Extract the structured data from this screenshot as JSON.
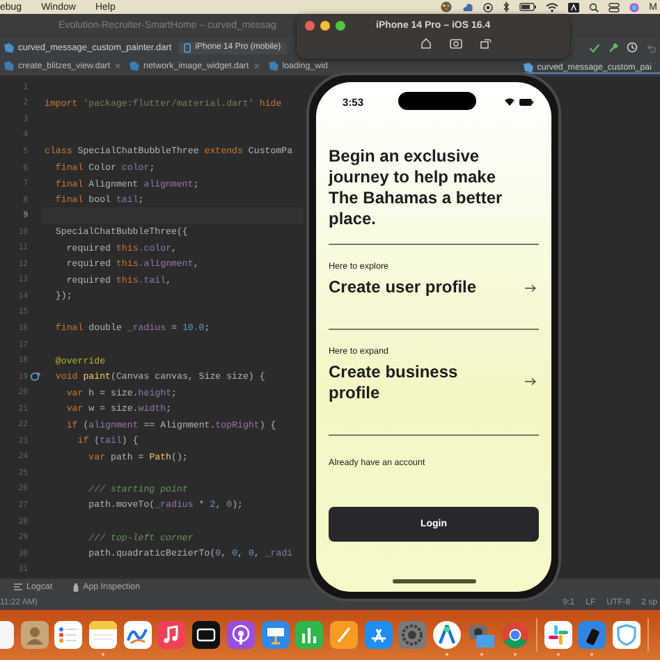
{
  "menu_bar": {
    "items": [
      "ebug",
      "Window",
      "Help"
    ],
    "trailing_text": "M"
  },
  "ide": {
    "title": "Evolution-Recruiter-SmartHome – curved_messag",
    "file_crumb": "curved_message_custom_painter.dart",
    "device": "iPhone 14 Pro (mobile)",
    "tabs": [
      {
        "label": "create_blitzes_view.dart",
        "selected": false,
        "closable": true
      },
      {
        "label": "network_image_widget.dart",
        "selected": false,
        "closable": true
      },
      {
        "label": "loading_wid",
        "selected": false,
        "closable": false
      },
      {
        "label": "curved_message_custom_pai",
        "selected": true,
        "closable": false
      }
    ],
    "lines": [
      {
        "number": "1",
        "current": false,
        "marker": false
      },
      {
        "number": "2",
        "current": false,
        "marker": false,
        "tokens": [
          {
            "kind": "kw",
            "text": "import "
          },
          {
            "kind": "str",
            "text": "'package:flutter/material.dart'"
          },
          {
            "kind": "kw",
            "text": " hide"
          }
        ]
      },
      {
        "number": "3",
        "current": false,
        "marker": false
      },
      {
        "number": "4",
        "current": false,
        "marker": false
      },
      {
        "number": "5",
        "current": false,
        "marker": false,
        "tokens": [
          {
            "kind": "kw",
            "text": "class "
          },
          {
            "kind": "plain",
            "text": "SpecialChatBubbleThree "
          },
          {
            "kind": "kw",
            "text": "extends "
          },
          {
            "kind": "plain",
            "text": "CustomPa"
          }
        ]
      },
      {
        "number": "6",
        "current": false,
        "marker": false,
        "tokens": [
          {
            "kind": "kw",
            "text": "  final "
          },
          {
            "kind": "plain",
            "text": "Color "
          },
          {
            "kind": "field",
            "text": "color"
          },
          {
            "kind": "plain",
            "text": ";"
          }
        ]
      },
      {
        "number": "7",
        "current": false,
        "marker": false,
        "tokens": [
          {
            "kind": "kw",
            "text": "  final "
          },
          {
            "kind": "plain",
            "text": "Alignment "
          },
          {
            "kind": "field",
            "text": "alignment"
          },
          {
            "kind": "plain",
            "text": ";"
          }
        ]
      },
      {
        "number": "8",
        "current": false,
        "marker": false,
        "tokens": [
          {
            "kind": "kw",
            "text": "  final "
          },
          {
            "kind": "plain",
            "text": "bool "
          },
          {
            "kind": "field",
            "text": "tail"
          },
          {
            "kind": "plain",
            "text": ";"
          }
        ]
      },
      {
        "number": "9",
        "current": true,
        "marker": false
      },
      {
        "number": "10",
        "current": false,
        "marker": false,
        "tokens": [
          {
            "kind": "plain",
            "text": "  SpecialChatBubbleThree({"
          }
        ]
      },
      {
        "number": "11",
        "current": false,
        "marker": false,
        "tokens": [
          {
            "kind": "plain",
            "text": "    required "
          },
          {
            "kind": "kw",
            "text": "this"
          },
          {
            "kind": "field",
            "text": ".color"
          },
          {
            "kind": "plain",
            "text": ","
          }
        ]
      },
      {
        "number": "12",
        "current": false,
        "marker": false,
        "tokens": [
          {
            "kind": "plain",
            "text": "    required "
          },
          {
            "kind": "kw",
            "text": "this"
          },
          {
            "kind": "field",
            "text": ".alignment"
          },
          {
            "kind": "plain",
            "text": ","
          }
        ]
      },
      {
        "number": "13",
        "current": false,
        "marker": false,
        "tokens": [
          {
            "kind": "plain",
            "text": "    required "
          },
          {
            "kind": "kw",
            "text": "this"
          },
          {
            "kind": "field",
            "text": ".tail"
          },
          {
            "kind": "plain",
            "text": ","
          }
        ]
      },
      {
        "number": "14",
        "current": false,
        "marker": false,
        "tokens": [
          {
            "kind": "plain",
            "text": "  });"
          }
        ]
      },
      {
        "number": "15",
        "current": false,
        "marker": false
      },
      {
        "number": "16",
        "current": false,
        "marker": false,
        "tokens": [
          {
            "kind": "kw",
            "text": "  final "
          },
          {
            "kind": "plain",
            "text": "double "
          },
          {
            "kind": "field",
            "text": "_radius"
          },
          {
            "kind": "plain",
            "text": " = "
          },
          {
            "kind": "num",
            "text": "10.0"
          },
          {
            "kind": "plain",
            "text": ";"
          }
        ]
      },
      {
        "number": "17",
        "current": false,
        "marker": false
      },
      {
        "number": "18",
        "current": false,
        "marker": false,
        "tokens": [
          {
            "kind": "ann",
            "text": "  @override"
          }
        ]
      },
      {
        "number": "19",
        "current": false,
        "marker": true,
        "tokens": [
          {
            "kind": "kw",
            "text": "  void "
          },
          {
            "kind": "fn",
            "text": "paint"
          },
          {
            "kind": "plain",
            "text": "(Canvas canvas, Size size) {"
          }
        ]
      },
      {
        "number": "20",
        "current": false,
        "marker": false,
        "tokens": [
          {
            "kind": "kw",
            "text": "    var "
          },
          {
            "kind": "plain",
            "text": "h = size."
          },
          {
            "kind": "field",
            "text": "height"
          },
          {
            "kind": "plain",
            "text": ";"
          }
        ]
      },
      {
        "number": "21",
        "current": false,
        "marker": false,
        "tokens": [
          {
            "kind": "kw",
            "text": "    var "
          },
          {
            "kind": "plain",
            "text": "w = size."
          },
          {
            "kind": "field",
            "text": "width"
          },
          {
            "kind": "plain",
            "text": ";"
          }
        ]
      },
      {
        "number": "22",
        "current": false,
        "marker": false,
        "tokens": [
          {
            "kind": "kw",
            "text": "    if "
          },
          {
            "kind": "plain",
            "text": "("
          },
          {
            "kind": "field",
            "text": "alignment"
          },
          {
            "kind": "plain",
            "text": " == Alignment."
          },
          {
            "kind": "field",
            "text": "topRight"
          },
          {
            "kind": "plain",
            "text": ") {"
          }
        ]
      },
      {
        "number": "23",
        "current": false,
        "marker": false,
        "tokens": [
          {
            "kind": "kw",
            "text": "      if "
          },
          {
            "kind": "plain",
            "text": "("
          },
          {
            "kind": "field",
            "text": "tail"
          },
          {
            "kind": "plain",
            "text": ") {"
          }
        ]
      },
      {
        "number": "24",
        "current": false,
        "marker": false,
        "tokens": [
          {
            "kind": "kw",
            "text": "        var "
          },
          {
            "kind": "plain",
            "text": "path = "
          },
          {
            "kind": "fn",
            "text": "Path"
          },
          {
            "kind": "plain",
            "text": "();"
          }
        ]
      },
      {
        "number": "25",
        "current": false,
        "marker": false
      },
      {
        "number": "26",
        "current": false,
        "marker": false,
        "tokens": [
          {
            "kind": "cmt",
            "text": "        /// starting point"
          }
        ]
      },
      {
        "number": "27",
        "current": false,
        "marker": false,
        "tokens": [
          {
            "kind": "plain",
            "text": "        path.moveTo("
          },
          {
            "kind": "field",
            "text": "_radius"
          },
          {
            "kind": "plain",
            "text": " * "
          },
          {
            "kind": "num",
            "text": "2"
          },
          {
            "kind": "plain",
            "text": ", "
          },
          {
            "kind": "num",
            "text": "0"
          },
          {
            "kind": "plain",
            "text": ");"
          }
        ]
      },
      {
        "number": "28",
        "current": false,
        "marker": false
      },
      {
        "number": "29",
        "current": false,
        "marker": false,
        "tokens": [
          {
            "kind": "cmt",
            "text": "        /// top-left corner"
          }
        ]
      },
      {
        "number": "30",
        "current": false,
        "marker": false,
        "tokens": [
          {
            "kind": "plain",
            "text": "        path.quadraticBezierTo("
          },
          {
            "kind": "num",
            "text": "0"
          },
          {
            "kind": "plain",
            "text": ", "
          },
          {
            "kind": "num",
            "text": "0"
          },
          {
            "kind": "plain",
            "text": ", "
          },
          {
            "kind": "num",
            "text": "0"
          },
          {
            "kind": "plain",
            "text": ", "
          },
          {
            "kind": "field",
            "text": "_radi"
          }
        ]
      },
      {
        "number": "31",
        "current": false,
        "marker": false
      }
    ],
    "tool_windows": [
      "Logcat",
      "App Inspection"
    ],
    "status_left": "11:22 AM)",
    "status_right": [
      "9:1",
      "LF",
      "UTF-8",
      "2 sp"
    ]
  },
  "simulator": {
    "title": "iPhone 14 Pro – iOS 16.4"
  },
  "phone": {
    "time": "3:53",
    "heading": "Begin an exclusive journey to help make The Bahamas a better place.",
    "options": [
      {
        "caption": "Here to explore",
        "title": "Create user profile"
      },
      {
        "caption": "Here to expand",
        "title": "Create business profile"
      }
    ],
    "account_text": "Already have an account",
    "login_button": "Login"
  }
}
